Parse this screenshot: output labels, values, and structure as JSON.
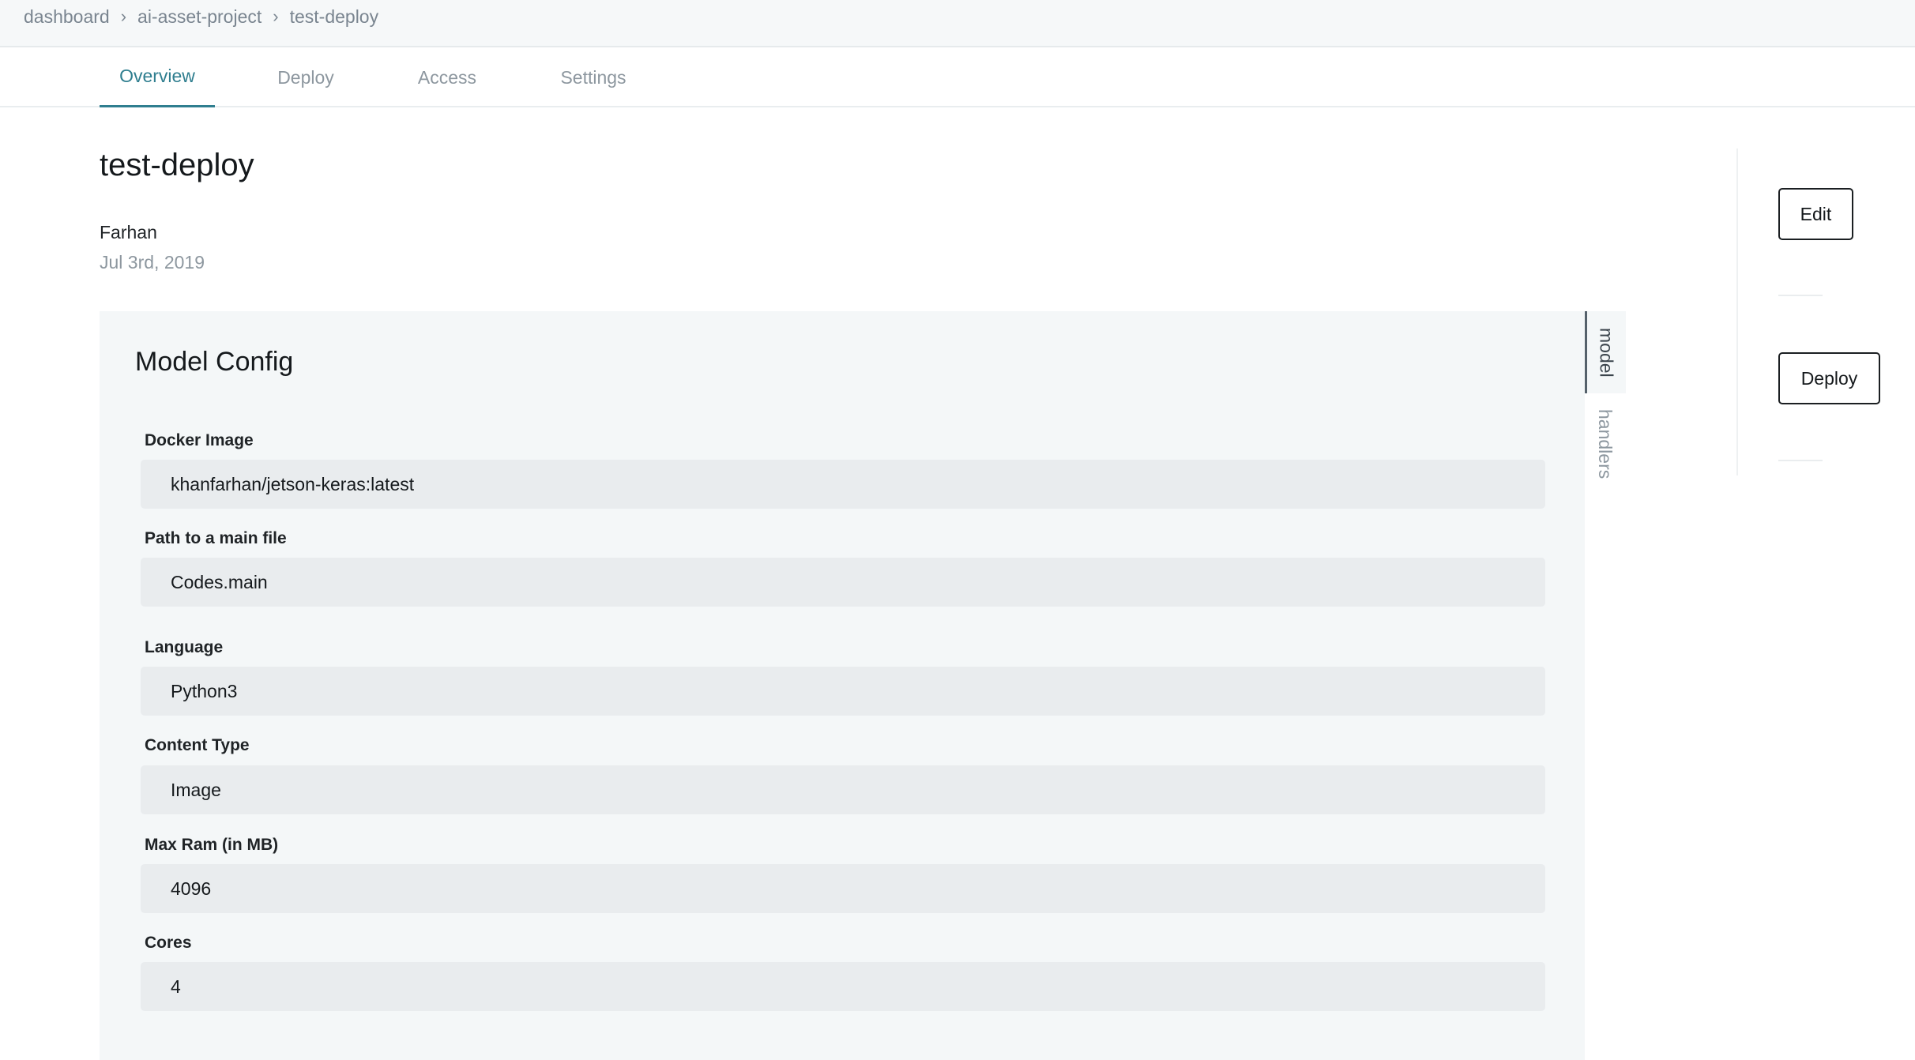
{
  "breadcrumb": {
    "items": [
      "dashboard",
      "ai-asset-project",
      "test-deploy"
    ],
    "separator": "›"
  },
  "tabs": [
    {
      "label": "Overview",
      "active": true
    },
    {
      "label": "Deploy",
      "active": false
    },
    {
      "label": "Access",
      "active": false
    },
    {
      "label": "Settings",
      "active": false
    }
  ],
  "header": {
    "title": "test-deploy",
    "author": "Farhan",
    "date": "Jul 3rd, 2019"
  },
  "actions": {
    "edit_label": "Edit",
    "deploy_label": "Deploy"
  },
  "model_config": {
    "title": "Model Config",
    "fields": [
      {
        "label": "Docker Image",
        "value": "khanfarhan/jetson-keras:latest"
      },
      {
        "label": "Path to a main file",
        "value": "Codes.main"
      },
      {
        "label": "Language",
        "value": "Python3"
      },
      {
        "label": "Content Type",
        "value": "Image"
      },
      {
        "label": "Max Ram (in MB)",
        "value": "4096"
      },
      {
        "label": "Cores",
        "value": "4"
      }
    ]
  },
  "side_tabs": [
    {
      "label": "model",
      "active": true
    },
    {
      "label": "handlers",
      "active": false
    }
  ],
  "colors": {
    "accent": "#2f7e8f",
    "panel_background": "#f4f7f8",
    "input_background": "#e9ecee",
    "muted_text": "#8d979f"
  }
}
